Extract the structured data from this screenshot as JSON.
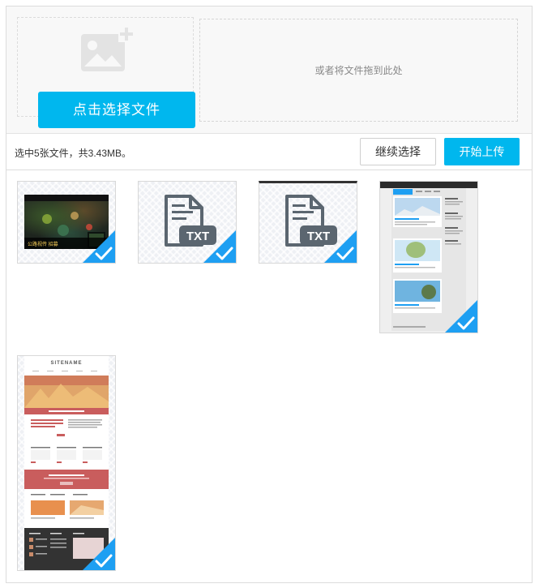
{
  "pick": {
    "button_label": "点击选择文件",
    "drop_hint": "或者将文件拖到此处"
  },
  "status": {
    "summary": "选中5张文件，共3.43MB。",
    "continue_label": "继续选择",
    "upload_label": "开始上传"
  },
  "files": [
    {
      "kind": "image",
      "thumb": "game-screenshot",
      "hud_text": "公路视传 招募",
      "selected": true
    },
    {
      "kind": "txt",
      "badge": "TXT",
      "selected": true
    },
    {
      "kind": "txt",
      "badge": "TXT",
      "selected": true
    },
    {
      "kind": "image",
      "thumb": "blog-template",
      "selected": true
    },
    {
      "kind": "image",
      "thumb": "sitename-template",
      "header_text": "SITENAME",
      "selected": true
    }
  ],
  "colors": {
    "accent": "#00b7ee",
    "check_badge": "#1e9ff2",
    "doc_icon": "#5b6670"
  }
}
